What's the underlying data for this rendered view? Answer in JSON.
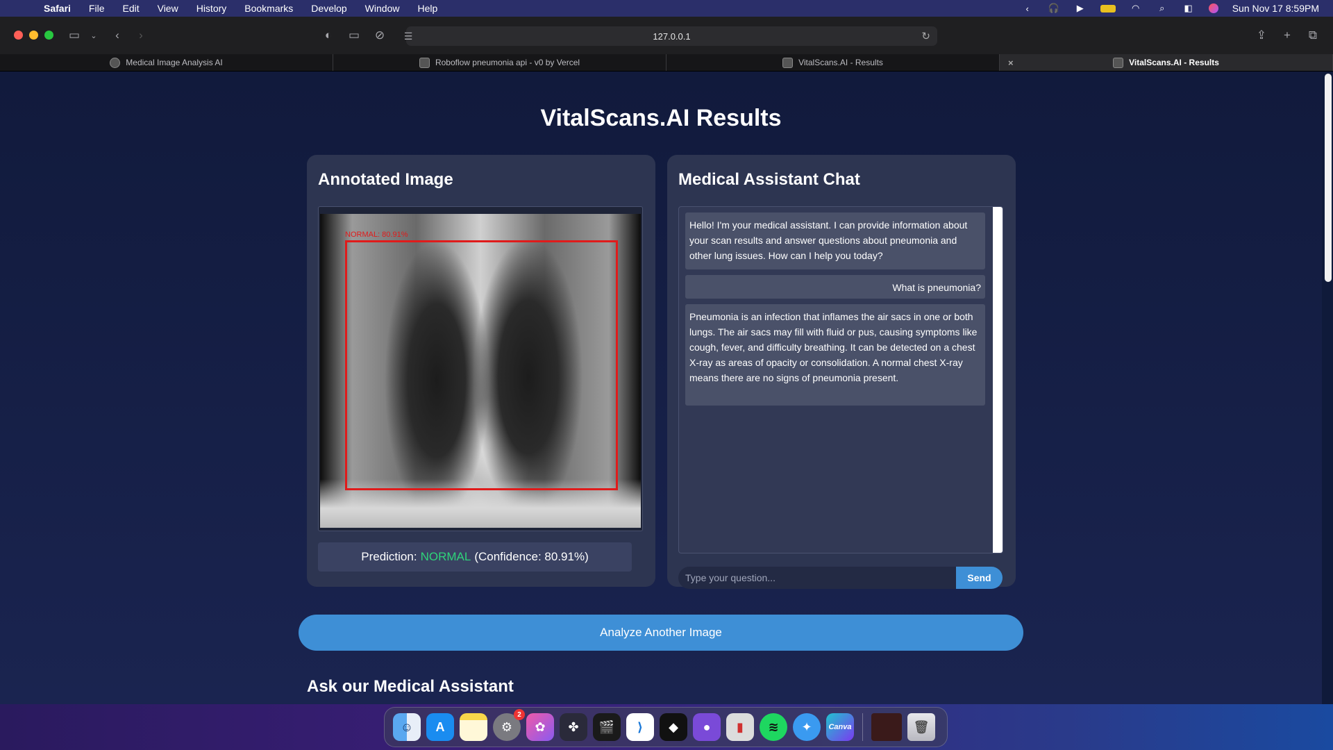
{
  "menubar": {
    "app_name": "Safari",
    "items": [
      "File",
      "Edit",
      "View",
      "History",
      "Bookmarks",
      "Develop",
      "Window",
      "Help"
    ],
    "clock": "Sun Nov 17  8:59PM"
  },
  "browser": {
    "url": "127.0.0.1",
    "tabs": [
      {
        "label": "Medical Image Analysis AI"
      },
      {
        "label": "Roboflow pneumonia api - v0 by Vercel"
      },
      {
        "label": "VitalScans.AI - Results"
      },
      {
        "label": "VitalScans.AI - Results",
        "close": "×"
      }
    ]
  },
  "page": {
    "title": "VitalScans.AI Results",
    "annotated_card": {
      "heading": "Annotated Image",
      "bbox_label": "NORMAL: 80.91%",
      "prediction_prefix": "Prediction:",
      "prediction_value": "NORMAL",
      "prediction_suffix": "(Confidence: 80.91%)"
    },
    "chat_card": {
      "heading": "Medical Assistant Chat",
      "messages": [
        {
          "role": "assistant",
          "text": "Hello! I'm your medical assistant. I can provide information about your scan results and answer questions about pneumonia and other lung issues. How can I help you today?"
        },
        {
          "role": "user",
          "text": "What is pneumonia?"
        },
        {
          "role": "assistant",
          "text": "Pneumonia is an infection that inflames the air sacs in one or both lungs. The air sacs may fill with fluid or pus, causing symptoms like cough, fever, and difficulty breathing. It can be detected on a chest X-ray as areas of opacity or consolidation. A normal chest X-ray means there are no signs of pneumonia present."
        }
      ],
      "input_placeholder": "Type your question...",
      "send_label": "Send"
    },
    "analyze_button": "Analyze Another Image",
    "ask_heading": "Ask our Medical Assistant"
  },
  "dock": {
    "badge_count": "2",
    "canva_label": "Canva"
  },
  "colors": {
    "accent": "#3e8fd6",
    "normal_green": "#2fd47a",
    "bbox_red": "#e01b1b",
    "card_bg": "#2d3551"
  }
}
